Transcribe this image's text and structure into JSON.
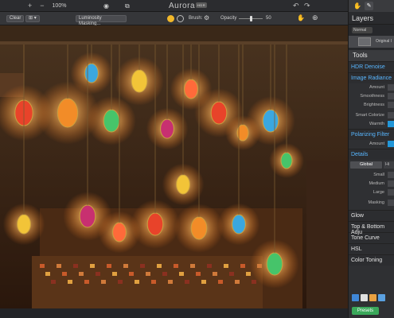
{
  "topbar": {
    "plus": "+",
    "minus": "−",
    "zoom": "100%",
    "title": "Aurora",
    "title_badge": "HDR",
    "eye_icon": "eye-icon",
    "split_icon": "split-view-icon",
    "undo_icon": "undo-icon",
    "redo_icon": "redo-icon"
  },
  "toolbar": {
    "clear_label": "Clear",
    "mode_label": "⊞ ▾",
    "luminosity_label": "Luminosity Masking...",
    "brush_label": "Brush:",
    "opacity_label": "Opacity",
    "opacity_value": "50",
    "opacity_fraction": 0.5
  },
  "panel": {
    "layers_title": "Layers",
    "blend_mode": "Normal",
    "layer_name": "Original I",
    "tools_title": "Tools",
    "sections": {
      "hdr_denoise": "HDR Denoise",
      "image_radiance": "Image Radiance",
      "amount": "Amount",
      "smoothness": "Smoothness",
      "brightness": "Brightness",
      "smart_colorize": "Smart Colorize",
      "warmth": "Warmth",
      "polarizing_filter": "Polarizing Filter",
      "polar_amount": "Amount",
      "details": "Details",
      "global": "Global",
      "hi": "Hi",
      "small": "Small",
      "medium": "Medium",
      "large": "Large",
      "masking": "Masking",
      "glow": "Glow",
      "top_bottom": "Top & Bottom Adju",
      "tone_curve": "Tone Curve",
      "hsl": "HSL",
      "color_toning": "Color Toning",
      "presets": "Presets"
    },
    "accent_blue": "#58b6ff",
    "accent_green": "#3aa85a"
  }
}
